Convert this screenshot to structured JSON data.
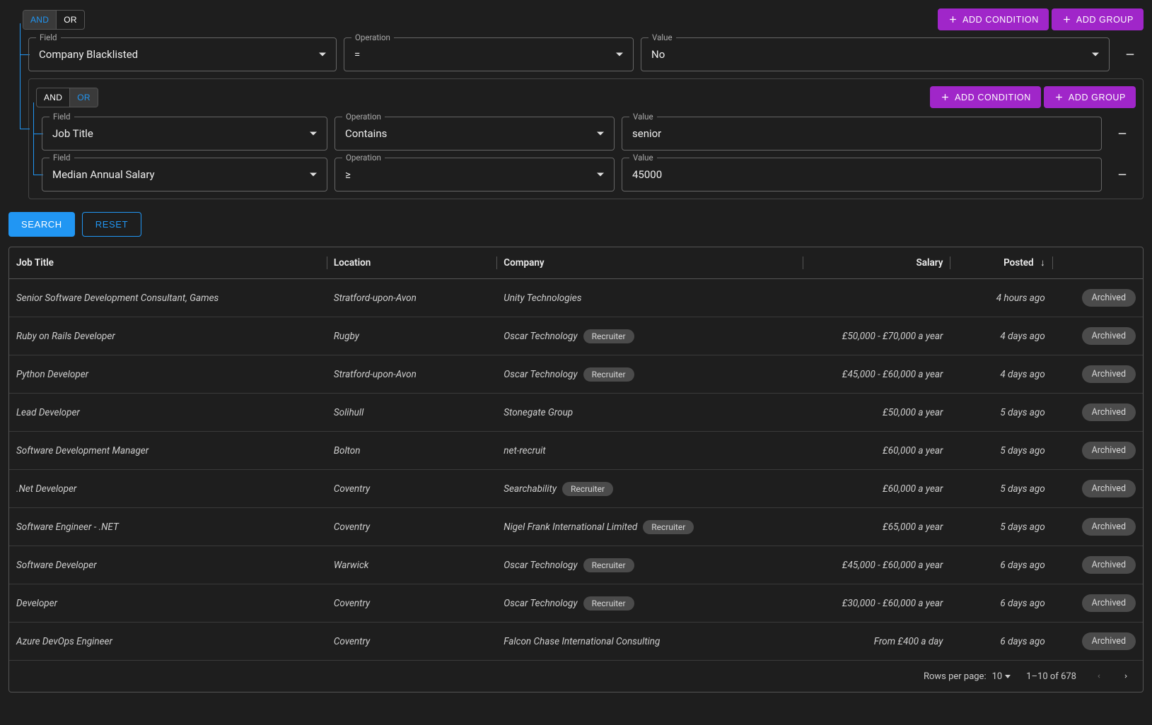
{
  "query": {
    "root": {
      "logic_and": "AND",
      "logic_or": "OR",
      "active_logic": "AND",
      "add_condition_label": "ADD CONDITION",
      "add_group_label": "ADD GROUP",
      "conditions": [
        {
          "field_label": "Field",
          "field_value": "Company Blacklisted",
          "op_label": "Operation",
          "op_value": "=",
          "val_label": "Value",
          "val_value": "No"
        }
      ],
      "nested": {
        "logic_and": "AND",
        "logic_or": "OR",
        "active_logic": "OR",
        "add_condition_label": "ADD CONDITION",
        "add_group_label": "ADD GROUP",
        "conditions": [
          {
            "field_label": "Field",
            "field_value": "Job Title",
            "op_label": "Operation",
            "op_value": "Contains",
            "val_label": "Value",
            "val_value": "senior"
          },
          {
            "field_label": "Field",
            "field_value": "Median Annual Salary",
            "op_label": "Operation",
            "op_value": "≥",
            "val_label": "Value",
            "val_value": "45000"
          }
        ]
      }
    }
  },
  "actions": {
    "search": "SEARCH",
    "reset": "RESET"
  },
  "table": {
    "columns": {
      "job_title": "Job Title",
      "location": "Location",
      "company": "Company",
      "salary": "Salary",
      "posted": "Posted"
    },
    "recruiter_chip": "Recruiter",
    "archived_label": "Archived",
    "rows": [
      {
        "title": "Senior Software Development Consultant, Games",
        "location": "Stratford-upon-Avon",
        "company": "Unity Technologies",
        "recruiter": false,
        "salary": "",
        "posted": "4 hours ago",
        "archived": true
      },
      {
        "title": "Ruby on Rails Developer",
        "location": "Rugby",
        "company": "Oscar Technology",
        "recruiter": true,
        "salary": "£50,000 - £70,000 a year",
        "posted": "4 days ago",
        "archived": true
      },
      {
        "title": "Python Developer",
        "location": "Stratford-upon-Avon",
        "company": "Oscar Technology",
        "recruiter": true,
        "salary": "£45,000 - £60,000 a year",
        "posted": "4 days ago",
        "archived": true
      },
      {
        "title": "Lead Developer",
        "location": "Solihull",
        "company": "Stonegate Group",
        "recruiter": false,
        "salary": "£50,000 a year",
        "posted": "5 days ago",
        "archived": true
      },
      {
        "title": "Software Development Manager",
        "location": "Bolton",
        "company": "net-recruit",
        "recruiter": false,
        "salary": "£60,000 a year",
        "posted": "5 days ago",
        "archived": true
      },
      {
        "title": ".Net Developer",
        "location": "Coventry",
        "company": "Searchability",
        "recruiter": true,
        "salary": "£60,000 a year",
        "posted": "5 days ago",
        "archived": true
      },
      {
        "title": "Software Engineer - .NET",
        "location": "Coventry",
        "company": "Nigel Frank International Limited",
        "recruiter": true,
        "salary": "£65,000 a year",
        "posted": "5 days ago",
        "archived": true
      },
      {
        "title": "Software Developer",
        "location": "Warwick",
        "company": "Oscar Technology",
        "recruiter": true,
        "salary": "£45,000 - £60,000 a year",
        "posted": "6 days ago",
        "archived": true
      },
      {
        "title": "Developer",
        "location": "Coventry",
        "company": "Oscar Technology",
        "recruiter": true,
        "salary": "£30,000 - £60,000 a year",
        "posted": "6 days ago",
        "archived": true
      },
      {
        "title": "Azure DevOps Engineer",
        "location": "Coventry",
        "company": "Falcon Chase International Consulting",
        "recruiter": false,
        "salary": "From £400 a day",
        "posted": "6 days ago",
        "archived": true
      }
    ],
    "pager": {
      "rows_per_page_label": "Rows per page:",
      "rows_per_page_value": "10",
      "range_text": "1–10 of 678"
    }
  }
}
